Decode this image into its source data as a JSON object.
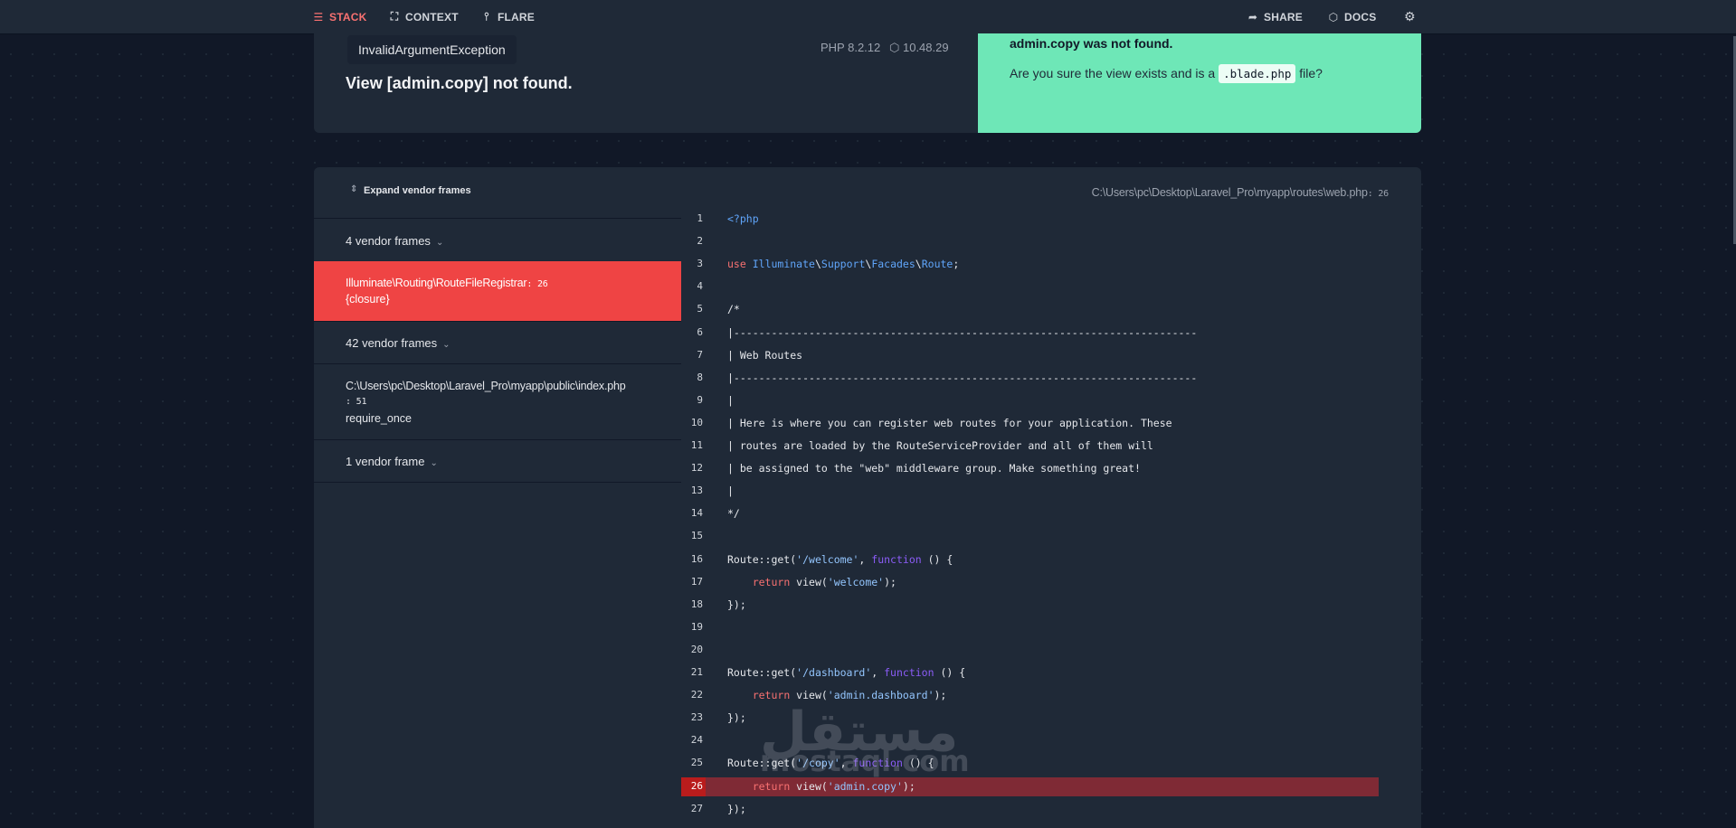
{
  "nav": {
    "stack": "STACK",
    "context": "CONTEXT",
    "flare": "FLARE",
    "share": "SHARE",
    "docs": "DOCS"
  },
  "header": {
    "exception_class": "InvalidArgumentException",
    "php_version": "PHP 8.2.12",
    "laravel_version": "10.48.29",
    "message": "View [admin.copy] not found."
  },
  "solution": {
    "title": "admin.copy was not found.",
    "text_before": "Are you sure the view exists and is a ",
    "code": ".blade.php",
    "text_after": " file?"
  },
  "frames": {
    "expand_label": "Expand vendor frames",
    "vendor_group_1": "4 vendor frames",
    "selected_path": "Illuminate\\Routing\\RouteFileRegistrar",
    "selected_line": ": 26",
    "selected_method": "{closure}",
    "vendor_group_2": "42 vendor frames",
    "app_path": "C:\\Users\\pc\\Desktop\\Laravel_Pro\\myapp\\public\\index.php",
    "app_line": ": 51",
    "app_method": "require_once",
    "vendor_group_3": "1 vendor frame"
  },
  "code": {
    "file_path": "C:\\Users\\pc\\Desktop\\Laravel_Pro\\myapp\\routes\\web.php",
    "file_line": ": 26",
    "highlight_line": 26,
    "lines": [
      {
        "n": "1",
        "t": "<?php"
      },
      {
        "n": "2",
        "t": ""
      },
      {
        "n": "3",
        "t": "use Illuminate\\Support\\Facades\\Route;"
      },
      {
        "n": "4",
        "t": ""
      },
      {
        "n": "5",
        "t": "/*"
      },
      {
        "n": "6",
        "t": "|--------------------------------------------------------------------------"
      },
      {
        "n": "7",
        "t": "| Web Routes"
      },
      {
        "n": "8",
        "t": "|--------------------------------------------------------------------------"
      },
      {
        "n": "9",
        "t": "|"
      },
      {
        "n": "10",
        "t": "| Here is where you can register web routes for your application. These"
      },
      {
        "n": "11",
        "t": "| routes are loaded by the RouteServiceProvider and all of them will"
      },
      {
        "n": "12",
        "t": "| be assigned to the \"web\" middleware group. Make something great!"
      },
      {
        "n": "13",
        "t": "|"
      },
      {
        "n": "14",
        "t": "*/"
      },
      {
        "n": "15",
        "t": ""
      },
      {
        "n": "16",
        "t": "Route::get('/welcome', function () {"
      },
      {
        "n": "17",
        "t": "    return view('welcome');"
      },
      {
        "n": "18",
        "t": "});"
      },
      {
        "n": "19",
        "t": ""
      },
      {
        "n": "20",
        "t": ""
      },
      {
        "n": "21",
        "t": "Route::get('/dashboard', function () {"
      },
      {
        "n": "22",
        "t": "    return view('admin.dashboard');"
      },
      {
        "n": "23",
        "t": "});"
      },
      {
        "n": "24",
        "t": ""
      },
      {
        "n": "25",
        "t": "Route::get('/copy', function () {"
      },
      {
        "n": "26",
        "t": "    return view('admin.copy');"
      },
      {
        "n": "27",
        "t": "});"
      }
    ]
  },
  "watermark": {
    "arabic": "مستقل",
    "latin": "mostaql.com"
  },
  "colors": {
    "background": "#111827",
    "panel": "#1f2937",
    "accent_red": "#ef4444",
    "solution_green": "#6ee7b7",
    "highlight_row": "#7f2a35"
  }
}
